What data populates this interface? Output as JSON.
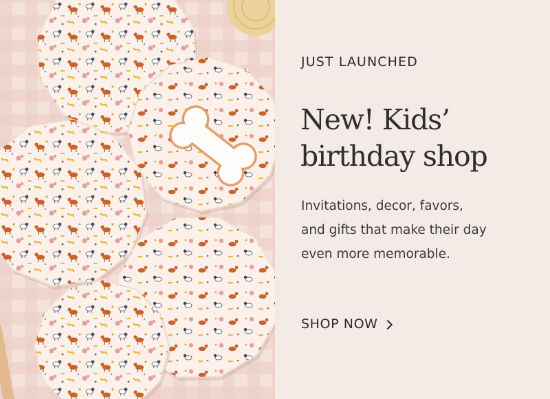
{
  "promo": {
    "eyebrow": "JUST LAUNCHED",
    "headline_line1": "New! Kids’",
    "headline_line2": "birthday shop",
    "body_line1": "Invitations, decor, favors,",
    "body_line2": "and gifts that make their day",
    "body_line3": "even more memorable.",
    "cta_label": "SHOP NOW"
  },
  "icons": {
    "cta": "chevron-right-icon",
    "image": "dog-party-plates-photo"
  },
  "colors": {
    "panel_background": "#f4ebe7",
    "text": "#2b2a2a",
    "plate": "#fbf0ea",
    "tablecloth": "#f3e3dc"
  }
}
